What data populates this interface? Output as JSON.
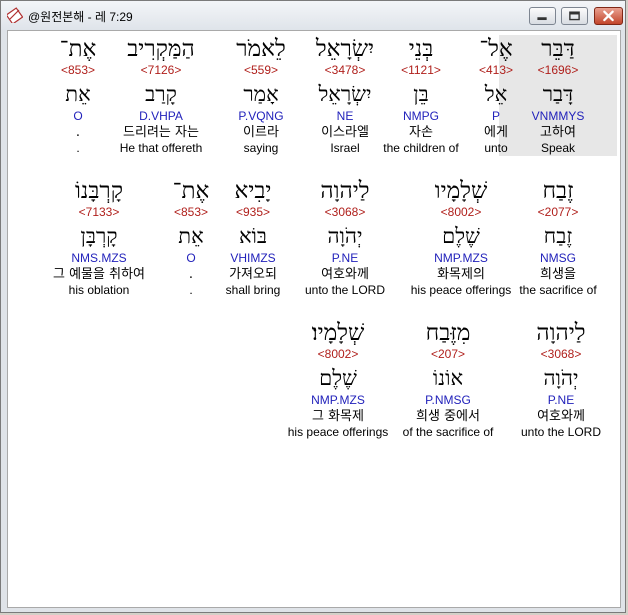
{
  "window": {
    "title": "@원전본해 - 레 7:29"
  },
  "colors": {
    "strong": "#b0201c",
    "morph": "#2222bb",
    "selected_bg": "#e7e7e7"
  },
  "icons": {
    "app": "book-icon",
    "minimize": "minimize-icon",
    "maximize": "maximize-icon",
    "close": "close-icon"
  },
  "words": [
    {
      "heb": "דַּבֵּר",
      "strong": "<1696>",
      "lemma": "דָּבַר",
      "morph": "VNMMYS",
      "kor": "고하여",
      "eng": "Speak"
    },
    {
      "heb": "אֶל־",
      "strong": "<413>",
      "lemma": "אֵל",
      "morph": "P",
      "kor": "에게",
      "eng": "unto"
    },
    {
      "heb": "בְּנֵי",
      "strong": "<1121>",
      "lemma": "בֵּן",
      "morph": "NMPG",
      "kor": "자손",
      "eng": "the children of"
    },
    {
      "heb": "יִשְׂרָאֵל",
      "strong": "<3478>",
      "lemma": "יִשְׂרָאֵל",
      "morph": "NE",
      "kor": "이스라엘",
      "eng": "Israel"
    },
    {
      "heb": "לֵאמֹר",
      "strong": "<559>",
      "lemma": "אָמַר",
      "morph": "P.VQNG",
      "kor": "이르라",
      "eng": "saying"
    },
    {
      "heb": "הַמַּקְרִיב",
      "strong": "<7126>",
      "lemma": "קָרַב",
      "morph": "D.VHPA",
      "kor": "드리려는 자는",
      "eng": "He that offereth"
    },
    {
      "heb": "אֶת־",
      "strong": "<853>",
      "lemma": "אֵת",
      "morph": "O",
      "kor": ".",
      "eng": "."
    },
    {
      "heb": "זֶבַח",
      "strong": "<2077>",
      "lemma": "זֶבַח",
      "morph": "NMSG",
      "kor": "희생을",
      "eng": "the sacrifice of"
    },
    {
      "heb": "שְׁלָמָיו",
      "strong": "<8002>",
      "lemma": "שֶׁלֶם",
      "morph": "NMP.MZS",
      "kor": "화목제의",
      "eng": "his peace offerings"
    },
    {
      "heb": "לַיהוָה",
      "strong": "<3068>",
      "lemma": "יְהֹוָה",
      "morph": "P.NE",
      "kor": "여호와께",
      "eng": "unto the LORD"
    },
    {
      "heb": "יָבִיא",
      "strong": "<935>",
      "lemma": "בּוֹא",
      "morph": "VHIMZS",
      "kor": "가져오되",
      "eng": "shall bring"
    },
    {
      "heb": "אֶת־",
      "strong": "<853>",
      "lemma": "אֵת",
      "morph": "O",
      "kor": ".",
      "eng": "."
    },
    {
      "heb": "קָרְבָּנוֹ",
      "strong": "<7133>",
      "lemma": "קָרְבָּן",
      "morph": "NMS.MZS",
      "kor": "그 예물을 취하여",
      "eng": "his oblation"
    },
    {
      "heb": "לַיהוָה",
      "strong": "<3068>",
      "lemma": "יְהֹוָה",
      "morph": "P.NE",
      "kor": "여호와께",
      "eng": "unto the LORD"
    },
    {
      "heb": "מִזֶּבַח",
      "strong": "<207>",
      "lemma": "אוֹנוֹ",
      "morph": "P.NMSG",
      "kor": "희생 중에서",
      "eng": "of the sacrifice of"
    },
    {
      "heb": "שְׁלָמָיו׃",
      "strong": "<8002>",
      "lemma": "שֶׁלֶם",
      "morph": "NMP.MZS",
      "kor": "그 화목제",
      "eng": "his peace offerings"
    }
  ]
}
